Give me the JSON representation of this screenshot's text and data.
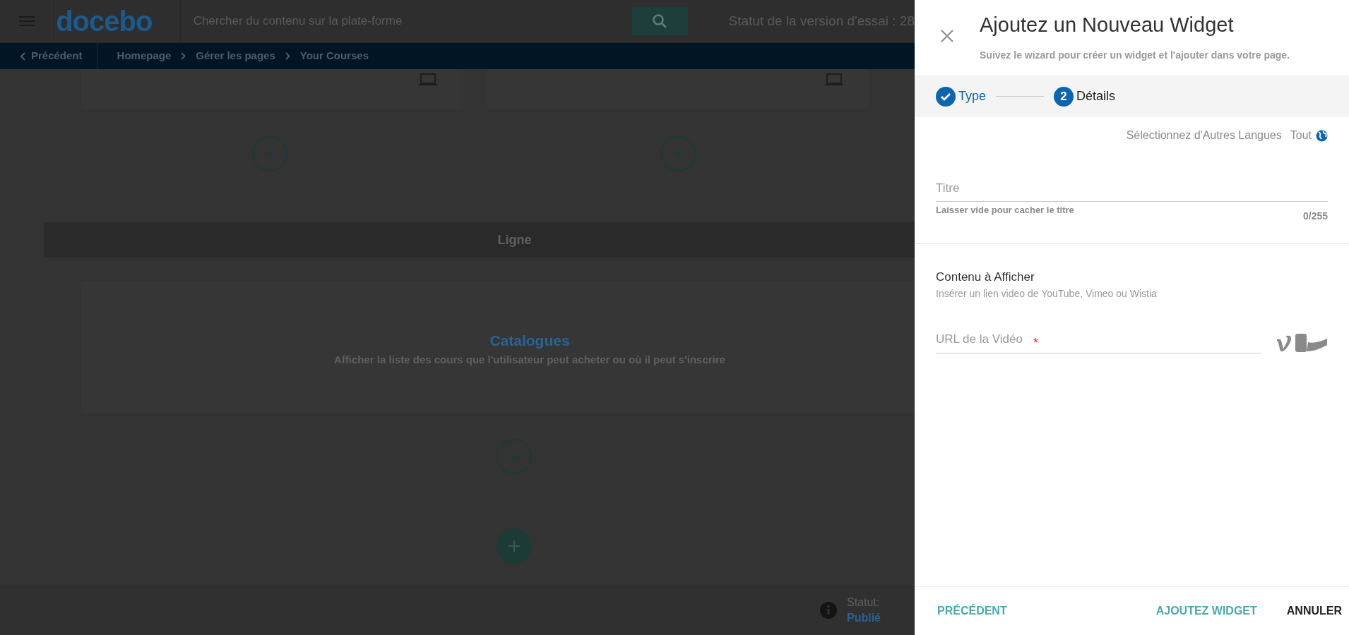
{
  "header": {
    "logo": "docebo",
    "search_placeholder": "Chercher du contenu sur la plate-forme",
    "trial_status": "Statut de la version d'essai : 28"
  },
  "breadcrumb": {
    "back": "Précédent",
    "items": [
      "Homepage",
      "Gérer les pages",
      "Your Courses"
    ]
  },
  "row_label": "Ligne",
  "widget": {
    "title": "Catalogues",
    "description": "Afficher la liste des cours que l'utilisateur peut acheter ou où il peut s'inscrire"
  },
  "status": {
    "label": "Statut:",
    "value": "Publié"
  },
  "panel": {
    "title": "Ajoutez un Nouveau Widget",
    "subtitle": "Suivez le wizard pour créer un widget et l'ajouter dans votre page.",
    "steps": [
      {
        "label": "Type",
        "done": true,
        "selected": false
      },
      {
        "label": "Détails",
        "number": "2",
        "done": false,
        "selected": true
      }
    ],
    "languages": {
      "label": "Sélectionnez d'Autres Langues",
      "value": "Tout"
    },
    "title_field": {
      "placeholder": "Titre",
      "hint": "Laisser vide pour cacher le titre",
      "counter": "0/255"
    },
    "content_section": {
      "heading": "Contenu à Afficher",
      "hint": "Insérer un lien video de YouTube, Vimeo ou Wistia"
    },
    "url_field": {
      "placeholder": "URL de la Vidéo",
      "required_mark": "*"
    },
    "buttons": [
      {
        "label": "PRÉCÉDENT",
        "kind": "secondary"
      },
      {
        "label": "AJOUTEZ WIDGET",
        "kind": "primary"
      },
      {
        "label": "ANNULER",
        "kind": "cancel"
      }
    ]
  }
}
